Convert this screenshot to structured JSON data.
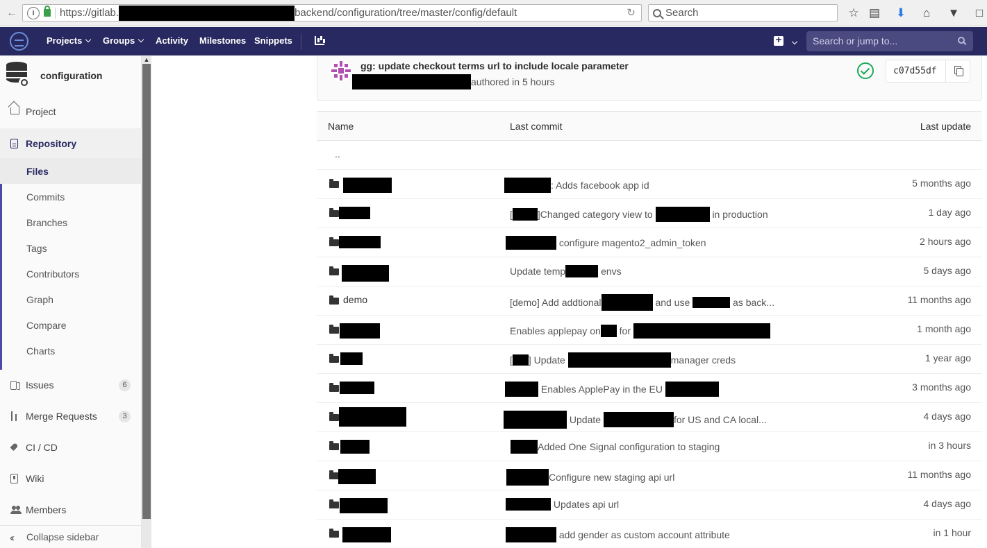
{
  "browser": {
    "url_start": "https://gitlab.",
    "url_end": "backend/configuration/tree/master/config/default",
    "search_placeholder": "Search"
  },
  "navbar": {
    "items": [
      "Projects",
      "Groups",
      "Activity",
      "Milestones",
      "Snippets"
    ],
    "search_placeholder": "Search or jump to..."
  },
  "sidebar": {
    "project_name": "configuration",
    "project": "Project",
    "repository": "Repository",
    "repo_items": [
      "Files",
      "Commits",
      "Branches",
      "Tags",
      "Contributors",
      "Graph",
      "Compare",
      "Charts"
    ],
    "issues": "Issues",
    "issues_count": "6",
    "merge_requests": "Merge Requests",
    "merge_requests_count": "3",
    "cicd": "CI / CD",
    "wiki": "Wiki",
    "members": "Members",
    "collapse": "Collapse sidebar"
  },
  "commit": {
    "title": "gg: update checkout terms url to include locale parameter",
    "meta": "authored in 5 hours",
    "sha": "c07d55df"
  },
  "tree": {
    "headers": {
      "name": "Name",
      "last_commit": "Last commit",
      "last_update": "Last update"
    },
    "parent": "..",
    "rows": [
      {
        "name": "",
        "commit": ": Adds facebook app id",
        "updated": "5 months ago"
      },
      {
        "name": "",
        "commit": "]Changed category view to",
        "commit2": "in production",
        "updated": "1 day ago"
      },
      {
        "name": "",
        "commit": "configure magento2_admin_token",
        "updated": "2 hours ago"
      },
      {
        "name": "",
        "commit": "Update temp",
        "commit2": "envs",
        "updated": "5 days ago"
      },
      {
        "name": "demo",
        "commit": "[demo] Add addtional",
        "commit2": "and use",
        "commit3": "as back...",
        "updated": "11 months ago"
      },
      {
        "name": "",
        "commit": "Enables applepay on",
        "commit2": "for",
        "updated": "1 month ago"
      },
      {
        "name": "",
        "commit": "Update",
        "commit2": "manager creds",
        "updated": "1 year ago"
      },
      {
        "name": "",
        "commit": "Enables ApplePay in the EU",
        "updated": "3 months ago"
      },
      {
        "name": "",
        "commit": "Update",
        "commit2": "for US and CA local...",
        "updated": "4 days ago"
      },
      {
        "name": "",
        "commit": "Added One Signal configuration to staging",
        "updated": "in 3 hours"
      },
      {
        "name": "",
        "commit": "Configure new staging api url",
        "updated": "11 months ago"
      },
      {
        "name": "",
        "commit": "Updates api url",
        "updated": "4 days ago"
      },
      {
        "name": "",
        "commit": "add gender as custom account attribute",
        "updated": "in 1 hour"
      }
    ]
  }
}
